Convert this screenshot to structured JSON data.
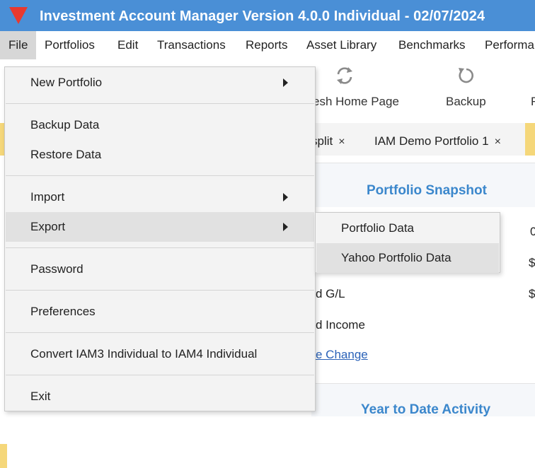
{
  "titlebar": {
    "title": "Investment Account Manager Version 4.0.0 Individual -  02/07/2024",
    "logo_color": "#e8392f",
    "bg_color": "#4a8fd6"
  },
  "menubar": {
    "items": [
      "File",
      "Portfolios",
      "Edit",
      "Transactions",
      "Reports",
      "Asset Library",
      "Benchmarks",
      "Performa"
    ]
  },
  "toolbar": {
    "refresh": {
      "label": "esh Home Page",
      "icon": "refresh-icon"
    },
    "backup": {
      "label": "Backup",
      "icon": "backup-icon"
    },
    "next_partial": {
      "label": "F"
    }
  },
  "tabs": {
    "items": [
      {
        "label": "split",
        "close": "×"
      },
      {
        "label": "IAM Demo Portfolio 1",
        "close": "×"
      }
    ]
  },
  "main": {
    "snapshot_title": "Portfolio Snapshot",
    "rows": [
      {
        "label": "",
        "value": "0"
      },
      {
        "label": "",
        "value": "$"
      },
      {
        "label": "d G/L",
        "value": "$"
      },
      {
        "label": "d Income",
        "value": ""
      }
    ],
    "change_link": "e Change",
    "ytd_title": "Year to Date Activity"
  },
  "file_menu": {
    "items": [
      {
        "label": "New Portfolio",
        "submenu": true
      },
      {
        "label": "Backup Data",
        "submenu": false
      },
      {
        "label": "Restore Data",
        "submenu": false
      },
      {
        "label": "Import",
        "submenu": true
      },
      {
        "label": "Export",
        "submenu": true,
        "highlighted": true
      },
      {
        "label": "Password",
        "submenu": false
      },
      {
        "label": "Preferences",
        "submenu": false
      },
      {
        "label": "Convert IAM3 Individual to IAM4 Individual",
        "submenu": false
      },
      {
        "label": "Exit",
        "submenu": false
      }
    ]
  },
  "export_submenu": {
    "items": [
      {
        "label": "Portfolio Data"
      },
      {
        "label": "Yahoo Portfolio Data",
        "highlighted": true
      }
    ]
  }
}
